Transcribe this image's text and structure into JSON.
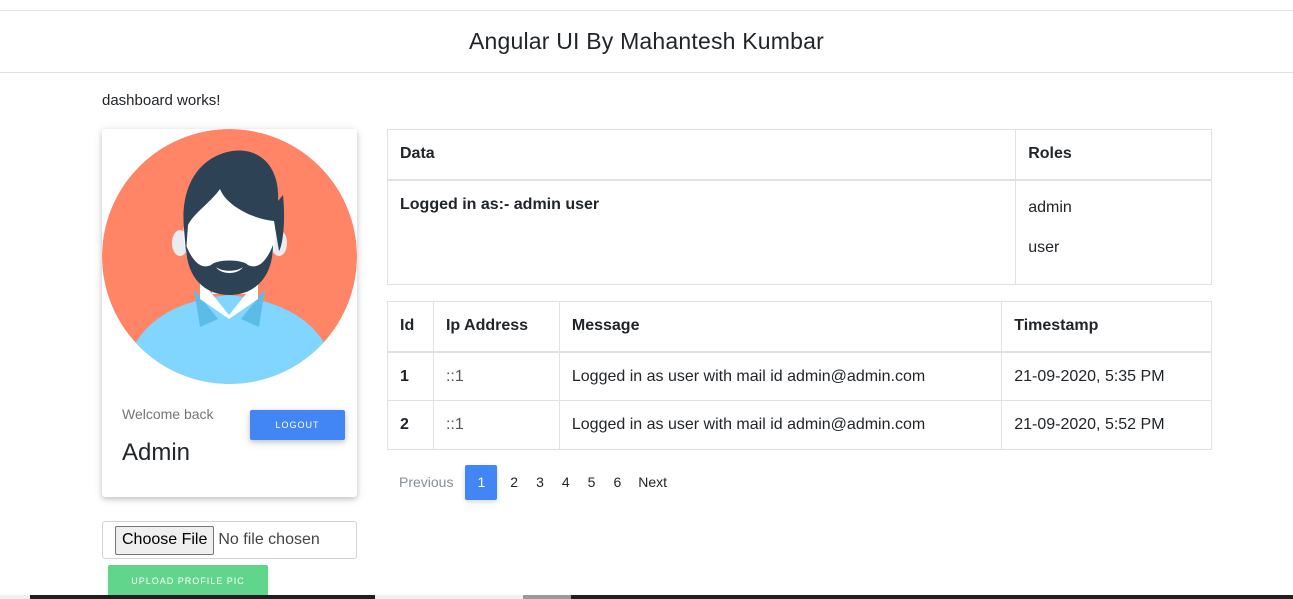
{
  "header": {
    "title": "Angular UI By Mahantesh Kumbar"
  },
  "dashboard": {
    "status_text": "dashboard works!"
  },
  "profile": {
    "welcome_text": "Welcome back",
    "name": "Admin",
    "logout_label": "LOGOUT",
    "avatar_icon": "user-avatar-icon",
    "colors": {
      "background": "#ff8566",
      "hair": "#2e4256",
      "shirt": "#80d6ff",
      "face": "#ffffff"
    }
  },
  "upload": {
    "choose_label": "Choose File",
    "no_file_text": "No file chosen",
    "upload_label": "UPLOAD PROFILE PIC"
  },
  "roles_table": {
    "headers": [
      "Data",
      "Roles"
    ],
    "data_text": "Logged in as:- admin user",
    "roles": [
      "admin",
      "user"
    ]
  },
  "log_table": {
    "headers": [
      "Id",
      "Ip Address",
      "Message",
      "Timestamp"
    ],
    "rows": [
      {
        "id": "1",
        "ip": "::1",
        "message": "Logged in as user with mail id admin@admin.com",
        "timestamp": "21-09-2020, 5:35 PM"
      },
      {
        "id": "2",
        "ip": "::1",
        "message": "Logged in as user with mail id admin@admin.com",
        "timestamp": "21-09-2020, 5:52 PM"
      }
    ]
  },
  "pagination": {
    "previous_label": "Previous",
    "pages": [
      "1",
      "2",
      "3",
      "4",
      "5",
      "6"
    ],
    "active_page": "1",
    "next_label": "Next"
  },
  "colors": {
    "primary": "#4285f4",
    "success": "#61d58c"
  }
}
